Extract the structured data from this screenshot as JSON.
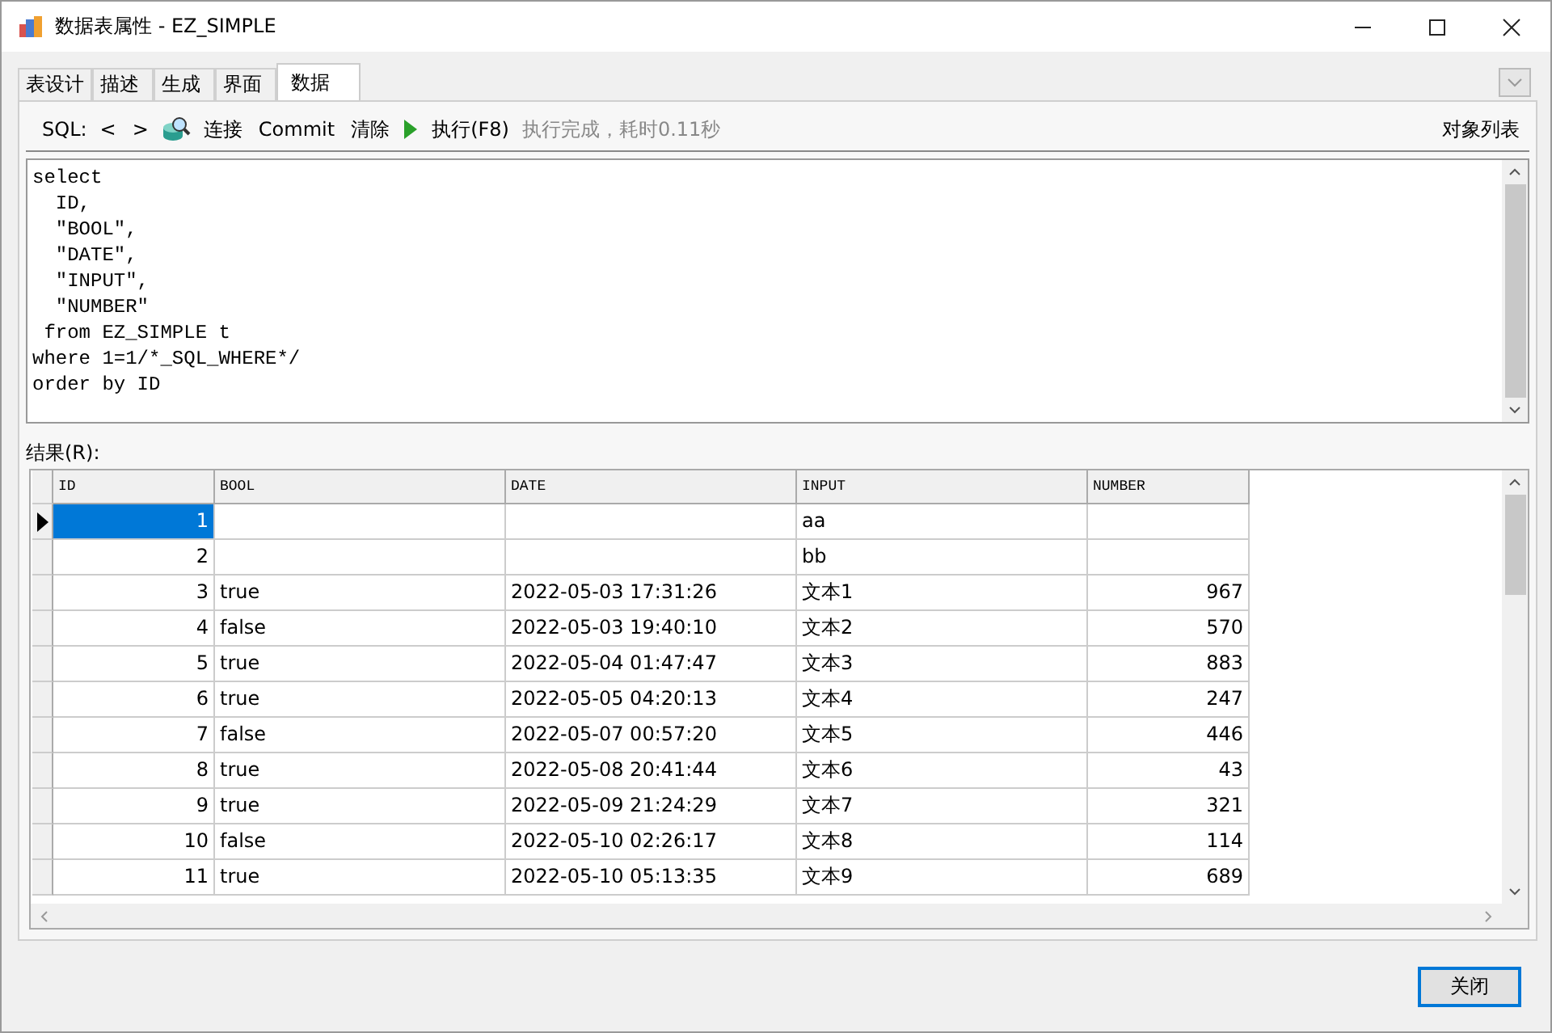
{
  "window": {
    "title": "数据表属性 - EZ_SIMPLE"
  },
  "tabs": [
    {
      "label": "表设计",
      "selected": false
    },
    {
      "label": "描述",
      "selected": false
    },
    {
      "label": "生成",
      "selected": false
    },
    {
      "label": "界面",
      "selected": false
    },
    {
      "label": "数据",
      "selected": true
    }
  ],
  "toolbar": {
    "sql_label": "SQL:",
    "prev": "<",
    "next": ">",
    "connect": "连接",
    "commit": "Commit",
    "clear": "清除",
    "execute": "执行(F8)",
    "status": "执行完成，耗时0.11秒",
    "object_list": "对象列表"
  },
  "sql_lines": [
    "select",
    "  ID,",
    "  \"BOOL\",",
    "  \"DATE\",",
    "  \"INPUT\",",
    "  \"NUMBER\"",
    " from EZ_SIMPLE t",
    "where 1=1/*_SQL_WHERE*/",
    "order by ID"
  ],
  "results": {
    "label": "结果(R):",
    "columns": [
      "ID",
      "BOOL",
      "DATE",
      "INPUT",
      "NUMBER"
    ],
    "rows": [
      {
        "selected": true,
        "cells": [
          "1",
          "",
          "",
          "aa",
          ""
        ]
      },
      {
        "selected": false,
        "cells": [
          "2",
          "",
          "",
          "bb",
          ""
        ]
      },
      {
        "selected": false,
        "cells": [
          "3",
          "true",
          "2022-05-03 17:31:26",
          "文本1",
          "967"
        ]
      },
      {
        "selected": false,
        "cells": [
          "4",
          "false",
          "2022-05-03 19:40:10",
          "文本2",
          "570"
        ]
      },
      {
        "selected": false,
        "cells": [
          "5",
          "true",
          "2022-05-04 01:47:47",
          "文本3",
          "883"
        ]
      },
      {
        "selected": false,
        "cells": [
          "6",
          "true",
          "2022-05-05 04:20:13",
          "文本4",
          "247"
        ]
      },
      {
        "selected": false,
        "cells": [
          "7",
          "false",
          "2022-05-07 00:57:20",
          "文本5",
          "446"
        ]
      },
      {
        "selected": false,
        "cells": [
          "8",
          "true",
          "2022-05-08 20:41:44",
          "文本6",
          "43"
        ]
      },
      {
        "selected": false,
        "cells": [
          "9",
          "true",
          "2022-05-09 21:24:29",
          "文本7",
          "321"
        ]
      },
      {
        "selected": false,
        "cells": [
          "10",
          "false",
          "2022-05-10 02:26:17",
          "文本8",
          "114"
        ]
      },
      {
        "selected": false,
        "cells": [
          "11",
          "true",
          "2022-05-10 05:13:35",
          "文本9",
          "689"
        ]
      }
    ]
  },
  "buttons": {
    "close": "关闭"
  }
}
